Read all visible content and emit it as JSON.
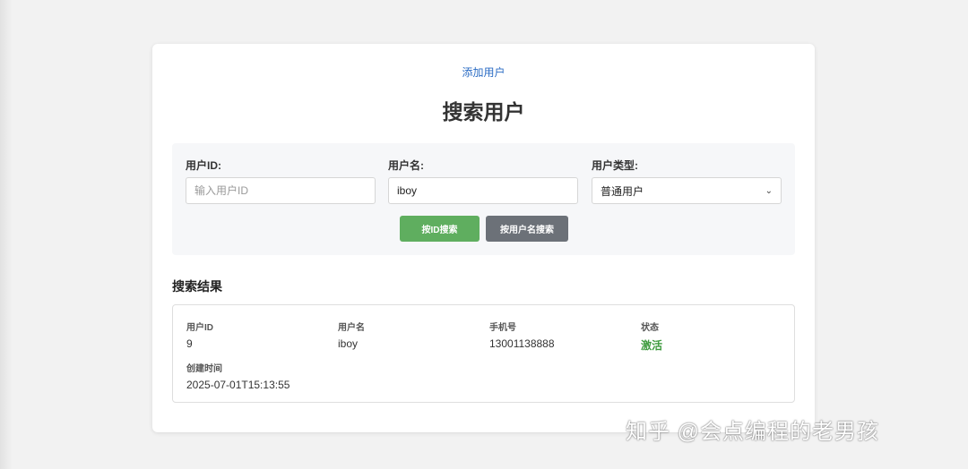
{
  "header": {
    "add_user_link": "添加用户",
    "title": "搜索用户"
  },
  "search": {
    "user_id": {
      "label": "用户ID:",
      "value": "",
      "placeholder": "输入用户ID"
    },
    "username": {
      "label": "用户名:",
      "value": "iboy",
      "placeholder": ""
    },
    "user_type": {
      "label": "用户类型:",
      "selected": "普通用户"
    },
    "search_by_id_button": "按ID搜索",
    "search_by_name_button": "按用户名搜索"
  },
  "results": {
    "title": "搜索结果",
    "fields": {
      "user_id": {
        "label": "用户ID",
        "value": "9"
      },
      "username": {
        "label": "用户名",
        "value": "iboy"
      },
      "phone": {
        "label": "手机号",
        "value": "13001138888"
      },
      "status": {
        "label": "状态",
        "value": "激活"
      },
      "created_at": {
        "label": "创建时间",
        "value": "2025-07-01T15:13:55"
      }
    }
  },
  "watermark": "知乎 @会点编程的老男孩",
  "colors": {
    "link": "#2b6cc4",
    "primary_button": "#5fae5f",
    "secondary_button": "#6c7178",
    "status_active": "#3d9a3d"
  }
}
